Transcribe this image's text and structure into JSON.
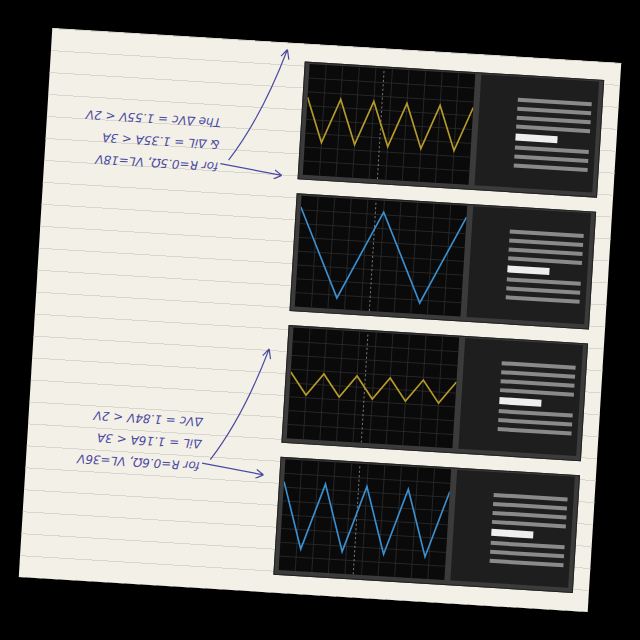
{
  "page": {
    "kind": "notebook page with oscilloscope printouts"
  },
  "notes": [
    {
      "lines": [
        "for R=0.6Ω, VL=36V",
        "ΔiL = 1.16A < 3A",
        "ΔVc = 1.84V < 2V"
      ]
    },
    {
      "lines": [
        "for R=0.5Ω, VL=18V",
        "& ΔiL = 1.35A < 3A",
        "The ΔVc = 1.55V < 2V"
      ]
    }
  ],
  "screenshots": [
    {
      "color": "#3a8fd0",
      "values": [
        2,
        8,
        2,
        8,
        2,
        8,
        2,
        8,
        2
      ]
    },
    {
      "color": "#b59a2a",
      "values": [
        4,
        6,
        4,
        6,
        4,
        6,
        4,
        6,
        4,
        6,
        4
      ]
    },
    {
      "color": "#3a8fd0",
      "values": [
        1,
        9,
        1,
        9,
        1
      ]
    },
    {
      "color": "#b59a2a",
      "values": [
        3,
        7,
        3,
        7,
        3,
        7,
        3,
        7,
        3,
        7,
        3
      ]
    }
  ]
}
